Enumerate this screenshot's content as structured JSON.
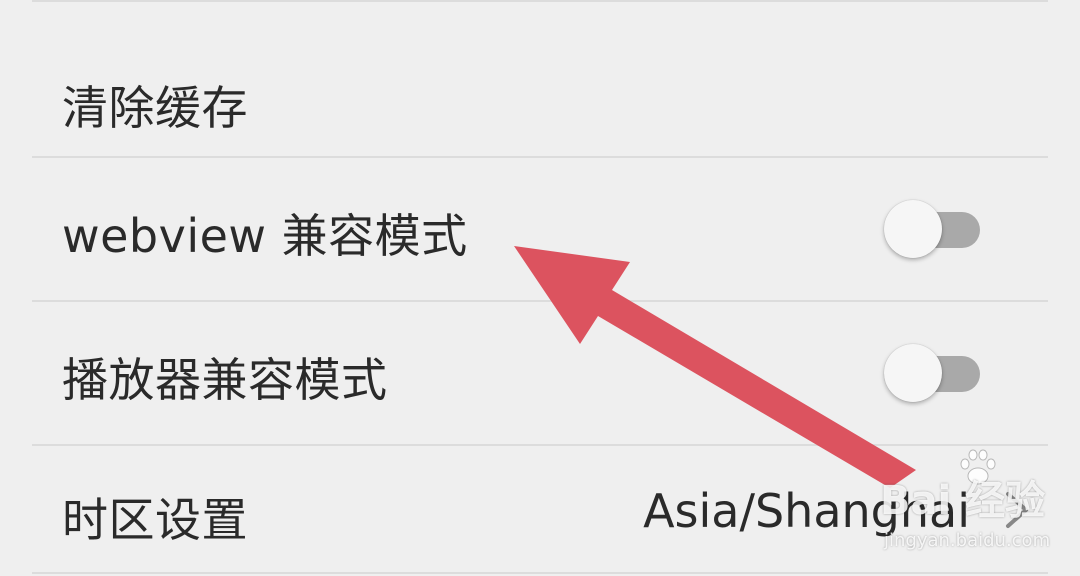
{
  "settings": {
    "items": [
      {
        "label": "清除缓存"
      },
      {
        "label": "webview 兼容模式",
        "toggle_on": false
      },
      {
        "label": "播放器兼容模式",
        "toggle_on": false
      },
      {
        "label": "时区设置",
        "value": "Asia/Shanghai"
      }
    ]
  },
  "icons": {
    "toggle_1": "toggle-switch-icon",
    "toggle_2": "toggle-switch-icon",
    "chevron": "chevron-right-icon",
    "arrow": "arrow-annotation-icon"
  },
  "colors": {
    "background": "#efefef",
    "text": "#2a2a2a",
    "divider": "#dcdcdc",
    "toggle_track": "#a9a9a9",
    "toggle_thumb": "#f6f6f6",
    "annotation_arrow": "#dc535f"
  },
  "watermark": {
    "main": "Bai 经验",
    "sub": "jingyan.baidu.com"
  }
}
